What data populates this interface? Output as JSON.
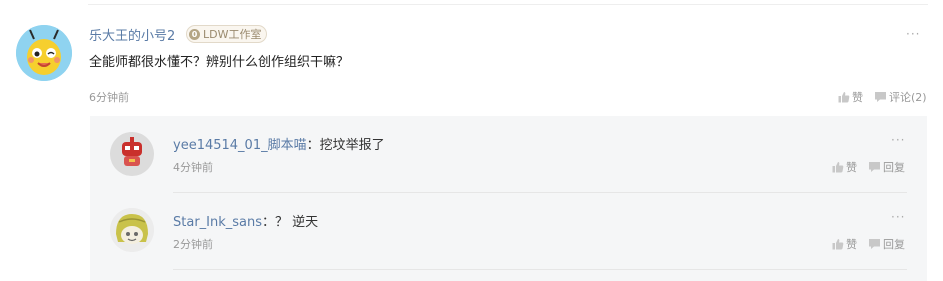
{
  "main_comment": {
    "username": "乐大王的小号2",
    "badge_initial": "0",
    "badge_label": "LDW工作室",
    "text": "全能师都很水懂不？辨别什么创作组织干嘛？",
    "time": "6分钟前",
    "like_label": "赞",
    "comment_label": "评论(2)",
    "avatar_icon": "yellow-cartoon-avatar"
  },
  "replies": [
    {
      "username": "yee14514_01_脚本喵",
      "separator": "：",
      "text": "挖坟举报了",
      "time": "4分钟前",
      "like_label": "赞",
      "reply_label": "回复",
      "avatar_icon": "red-robot-avatar"
    },
    {
      "username": "Star_Ink_sans",
      "separator": "：",
      "text": "？ 逆天",
      "time": "2分钟前",
      "like_label": "赞",
      "reply_label": "回复",
      "avatar_icon": "yellow-hood-avatar"
    }
  ],
  "more_label": "···",
  "colors": {
    "username": "#5a7ba6",
    "reply_background": "#f5f6f7",
    "muted": "#999999"
  }
}
